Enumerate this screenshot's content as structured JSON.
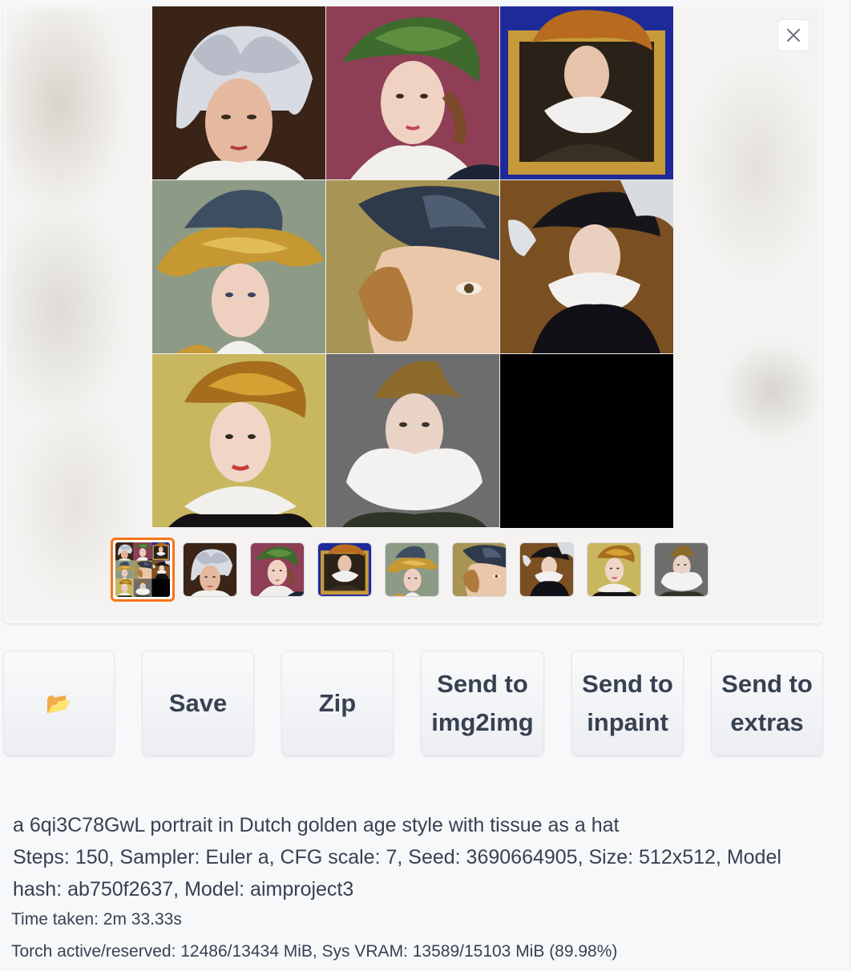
{
  "gallery": {
    "close_icon": "close-icon",
    "thumbnail_count": 9,
    "selected_thumbnail": 1
  },
  "actions": {
    "open_folder_icon": "folder-icon",
    "open_folder_glyph": "📂",
    "save_label": "Save",
    "zip_label": "Zip",
    "send_img2img_line1": "Send to",
    "send_img2img_line2": "img2img",
    "send_inpaint_line1": "Send to",
    "send_inpaint_line2": "inpaint",
    "send_extras_line1": "Send to",
    "send_extras_line2": "extras"
  },
  "info": {
    "prompt": "a 6qi3C78GwL portrait in Dutch golden age style with tissue as a hat",
    "params": "Steps: 150, Sampler: Euler a, CFG scale: 7, Seed: 3690664905, Size: 512x512, Model hash: ab750f2637, Model: aimproject3",
    "time_taken": "Time taken: 2m 33.33s",
    "torch": "Torch active/reserved: 12486/13434 MiB, Sys VRAM: 13589/15103 MiB (89.98%)"
  },
  "colors": {
    "accent": "#f97316",
    "text": "#374151"
  }
}
